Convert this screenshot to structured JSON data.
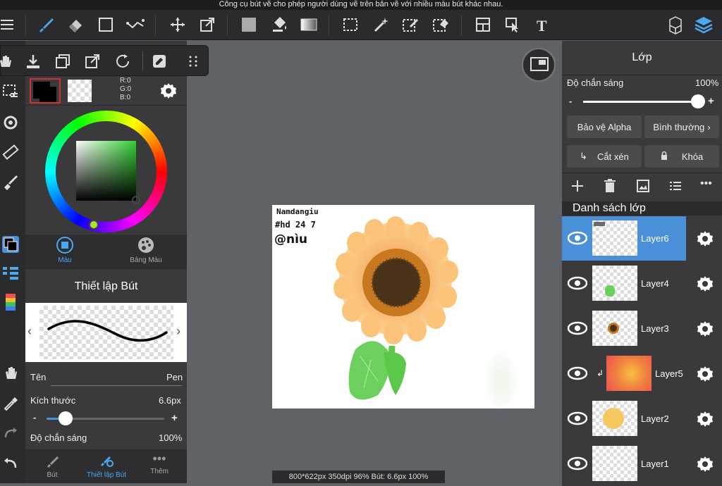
{
  "topbar": {
    "tooltip": "Công cụ bút vẽ cho phép người dùng vẽ trên bản vẽ với nhiều màu bút khác nhau."
  },
  "color": {
    "r": "R:0",
    "g": "G:0",
    "b": "B:0",
    "main": "#000000"
  },
  "color_tabs": {
    "color": "Màu",
    "palette": "Bảng Màu"
  },
  "brush": {
    "title": "Thiết lập Bút",
    "name_label": "Tên",
    "name_value": "Pen",
    "size_label": "Kích thước",
    "size_value": "6.6px",
    "size_fraction": 0.1,
    "opacity_label": "Độ chắn sáng",
    "opacity_value": "100%",
    "minus": "-",
    "plus": "+"
  },
  "bottom_tabs": {
    "pen": "Bút",
    "pen_settings": "Thiết lập Bút",
    "more": "Thêm"
  },
  "layers": {
    "title": "Lớp",
    "opacity_label": "Độ chắn sáng",
    "opacity_value": "100%",
    "opacity_fraction": 1.0,
    "minus": "-",
    "plus": "+",
    "alpha_protect": "Bảo vệ Alpha",
    "blend_mode": "Bình thường",
    "clipping": "Cắt xén",
    "lock": "Khóa",
    "list_title": "Danh sách lớp",
    "items": [
      {
        "name": "Layer6",
        "selected": true
      },
      {
        "name": "Layer4",
        "selected": false
      },
      {
        "name": "Layer3",
        "selected": false
      },
      {
        "name": "Layer5",
        "selected": false,
        "clipped": true
      },
      {
        "name": "Layer2",
        "selected": false
      },
      {
        "name": "Layer1",
        "selected": false
      }
    ]
  },
  "canvas": {
    "handwriting_line1": "Namdangiu",
    "handwriting_line2": "#hd 24 7",
    "handwriting_line3": "@nìu"
  },
  "status": {
    "text": "800*622px 350dpi 96% Bút: 6.6px 100%"
  },
  "colors": {
    "accent": "#4a90d9",
    "toolbar": "#2b2b2d",
    "panel": "#3a3a3c",
    "canvas_bg": "#5f6266"
  }
}
